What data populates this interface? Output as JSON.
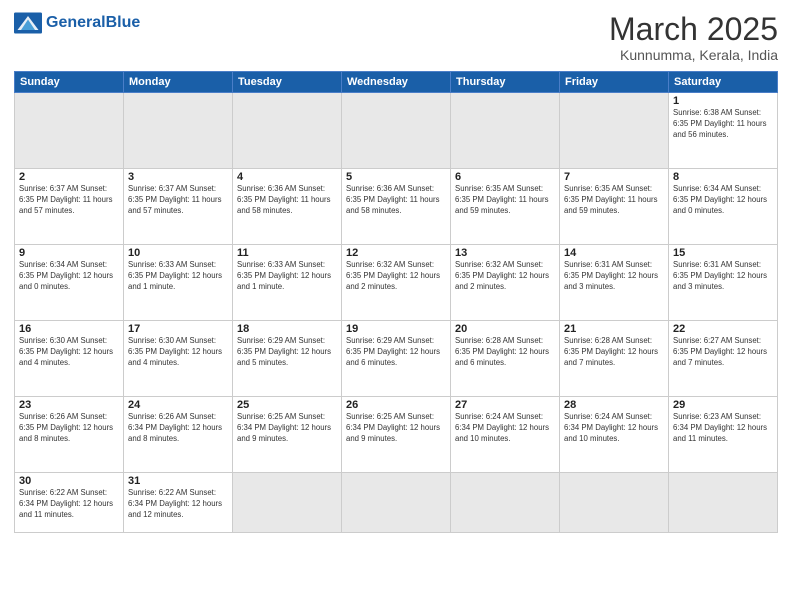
{
  "header": {
    "logo_general": "General",
    "logo_blue": "Blue",
    "month": "March 2025",
    "location": "Kunnumma, Kerala, India"
  },
  "days_of_week": [
    "Sunday",
    "Monday",
    "Tuesday",
    "Wednesday",
    "Thursday",
    "Friday",
    "Saturday"
  ],
  "weeks": [
    [
      {
        "day": "",
        "empty": true
      },
      {
        "day": "",
        "empty": true
      },
      {
        "day": "",
        "empty": true
      },
      {
        "day": "",
        "empty": true
      },
      {
        "day": "",
        "empty": true
      },
      {
        "day": "",
        "empty": true
      },
      {
        "day": "1",
        "info": "Sunrise: 6:38 AM\nSunset: 6:35 PM\nDaylight: 11 hours\nand 56 minutes."
      }
    ],
    [
      {
        "day": "2",
        "info": "Sunrise: 6:37 AM\nSunset: 6:35 PM\nDaylight: 11 hours\nand 57 minutes."
      },
      {
        "day": "3",
        "info": "Sunrise: 6:37 AM\nSunset: 6:35 PM\nDaylight: 11 hours\nand 57 minutes."
      },
      {
        "day": "4",
        "info": "Sunrise: 6:36 AM\nSunset: 6:35 PM\nDaylight: 11 hours\nand 58 minutes."
      },
      {
        "day": "5",
        "info": "Sunrise: 6:36 AM\nSunset: 6:35 PM\nDaylight: 11 hours\nand 58 minutes."
      },
      {
        "day": "6",
        "info": "Sunrise: 6:35 AM\nSunset: 6:35 PM\nDaylight: 11 hours\nand 59 minutes."
      },
      {
        "day": "7",
        "info": "Sunrise: 6:35 AM\nSunset: 6:35 PM\nDaylight: 11 hours\nand 59 minutes."
      },
      {
        "day": "8",
        "info": "Sunrise: 6:34 AM\nSunset: 6:35 PM\nDaylight: 12 hours\nand 0 minutes."
      }
    ],
    [
      {
        "day": "9",
        "info": "Sunrise: 6:34 AM\nSunset: 6:35 PM\nDaylight: 12 hours\nand 0 minutes."
      },
      {
        "day": "10",
        "info": "Sunrise: 6:33 AM\nSunset: 6:35 PM\nDaylight: 12 hours\nand 1 minute."
      },
      {
        "day": "11",
        "info": "Sunrise: 6:33 AM\nSunset: 6:35 PM\nDaylight: 12 hours\nand 1 minute."
      },
      {
        "day": "12",
        "info": "Sunrise: 6:32 AM\nSunset: 6:35 PM\nDaylight: 12 hours\nand 2 minutes."
      },
      {
        "day": "13",
        "info": "Sunrise: 6:32 AM\nSunset: 6:35 PM\nDaylight: 12 hours\nand 2 minutes."
      },
      {
        "day": "14",
        "info": "Sunrise: 6:31 AM\nSunset: 6:35 PM\nDaylight: 12 hours\nand 3 minutes."
      },
      {
        "day": "15",
        "info": "Sunrise: 6:31 AM\nSunset: 6:35 PM\nDaylight: 12 hours\nand 3 minutes."
      }
    ],
    [
      {
        "day": "16",
        "info": "Sunrise: 6:30 AM\nSunset: 6:35 PM\nDaylight: 12 hours\nand 4 minutes."
      },
      {
        "day": "17",
        "info": "Sunrise: 6:30 AM\nSunset: 6:35 PM\nDaylight: 12 hours\nand 4 minutes."
      },
      {
        "day": "18",
        "info": "Sunrise: 6:29 AM\nSunset: 6:35 PM\nDaylight: 12 hours\nand 5 minutes."
      },
      {
        "day": "19",
        "info": "Sunrise: 6:29 AM\nSunset: 6:35 PM\nDaylight: 12 hours\nand 6 minutes."
      },
      {
        "day": "20",
        "info": "Sunrise: 6:28 AM\nSunset: 6:35 PM\nDaylight: 12 hours\nand 6 minutes."
      },
      {
        "day": "21",
        "info": "Sunrise: 6:28 AM\nSunset: 6:35 PM\nDaylight: 12 hours\nand 7 minutes."
      },
      {
        "day": "22",
        "info": "Sunrise: 6:27 AM\nSunset: 6:35 PM\nDaylight: 12 hours\nand 7 minutes."
      }
    ],
    [
      {
        "day": "23",
        "info": "Sunrise: 6:26 AM\nSunset: 6:35 PM\nDaylight: 12 hours\nand 8 minutes."
      },
      {
        "day": "24",
        "info": "Sunrise: 6:26 AM\nSunset: 6:34 PM\nDaylight: 12 hours\nand 8 minutes."
      },
      {
        "day": "25",
        "info": "Sunrise: 6:25 AM\nSunset: 6:34 PM\nDaylight: 12 hours\nand 9 minutes."
      },
      {
        "day": "26",
        "info": "Sunrise: 6:25 AM\nSunset: 6:34 PM\nDaylight: 12 hours\nand 9 minutes."
      },
      {
        "day": "27",
        "info": "Sunrise: 6:24 AM\nSunset: 6:34 PM\nDaylight: 12 hours\nand 10 minutes."
      },
      {
        "day": "28",
        "info": "Sunrise: 6:24 AM\nSunset: 6:34 PM\nDaylight: 12 hours\nand 10 minutes."
      },
      {
        "day": "29",
        "info": "Sunrise: 6:23 AM\nSunset: 6:34 PM\nDaylight: 12 hours\nand 11 minutes."
      }
    ],
    [
      {
        "day": "30",
        "info": "Sunrise: 6:22 AM\nSunset: 6:34 PM\nDaylight: 12 hours\nand 11 minutes."
      },
      {
        "day": "31",
        "info": "Sunrise: 6:22 AM\nSunset: 6:34 PM\nDaylight: 12 hours\nand 12 minutes."
      },
      {
        "day": "",
        "empty": true
      },
      {
        "day": "",
        "empty": true
      },
      {
        "day": "",
        "empty": true
      },
      {
        "day": "",
        "empty": true
      },
      {
        "day": "",
        "empty": true
      }
    ]
  ]
}
